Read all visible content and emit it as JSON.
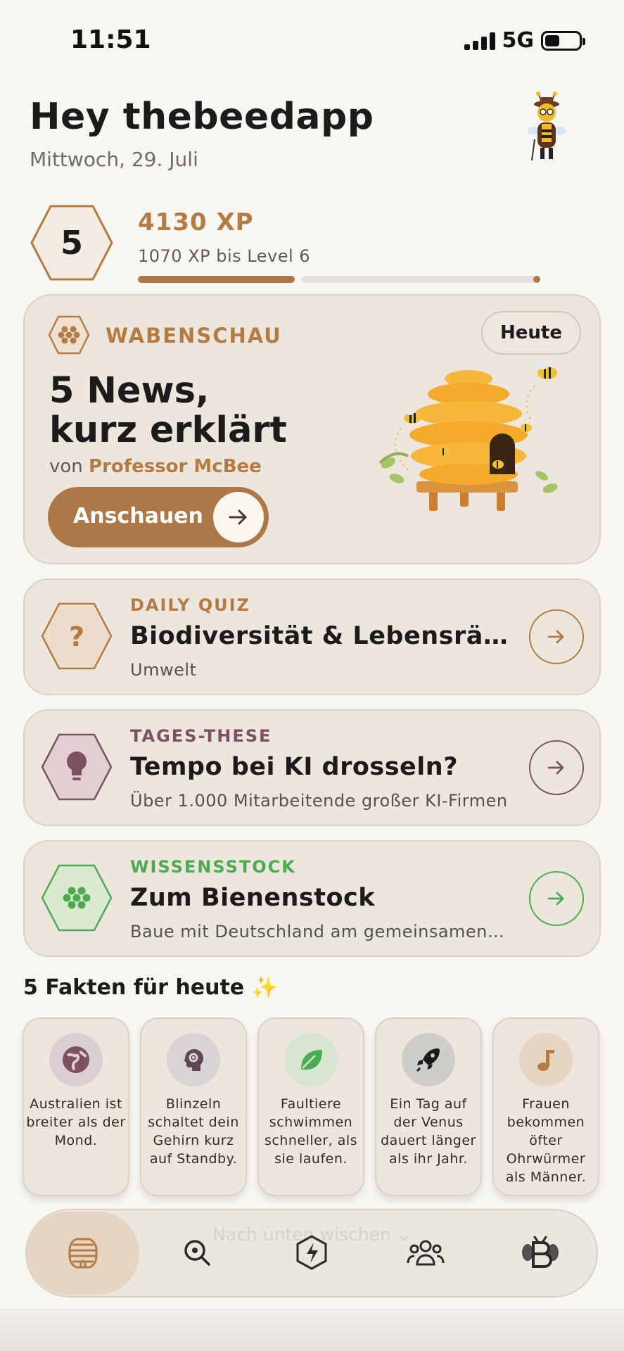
{
  "status_bar": {
    "time": "11:51",
    "network": "5G"
  },
  "header": {
    "greeting": "Hey thebeedapp",
    "date": "Mittwoch, 29. Juli"
  },
  "level": {
    "number": "5",
    "xp": "4130 XP",
    "xp_to_next": "1070 XP bis Level 6",
    "progress_fraction": 0.39
  },
  "hero": {
    "label": "WABENSCHAU",
    "badge": "Heute",
    "title_line1": "5 News,",
    "title_line2": "kurz erklärt",
    "by_prefix": "von",
    "by_author": "Professor McBee",
    "cta": "Anschauen"
  },
  "cards": [
    {
      "eyebrow": "DAILY QUIZ",
      "title": "Biodiversität & Lebensräume",
      "subtitle": "Umwelt",
      "accent": "#b57b45",
      "icon": "question-icon"
    },
    {
      "eyebrow": "TAGES-THESE",
      "title": "Tempo bei KI drosseln?",
      "subtitle": "Über 1.000 Mitarbeitende großer KI-Firmen",
      "accent": "#7d5162",
      "icon": "lightbulb-icon"
    },
    {
      "eyebrow": "WISSENSSTOCK",
      "title": "Zum Bienenstock",
      "subtitle": "Baue mit Deutschland am gemeinsamen Wissen",
      "accent": "#4caa50",
      "icon": "honeycomb-icon"
    }
  ],
  "facts": {
    "title": "5 Fakten für heute ✨",
    "items": [
      {
        "text": "Australien ist breiter als der Mond.",
        "icon": "globe-icon"
      },
      {
        "text": "Blinzeln schaltet dein Gehirn kurz auf Standby.",
        "icon": "brain-gear-icon"
      },
      {
        "text": "Faultiere schwimmen schneller, als sie laufen.",
        "icon": "leaf-icon"
      },
      {
        "text": "Ein Tag auf der Venus dauert länger als ihr Jahr.",
        "icon": "rocket-icon"
      },
      {
        "text": "Frauen bekommen öfter Ohrwürmer als Männer.",
        "icon": "music-note-icon"
      }
    ]
  },
  "nav": {
    "swipe_hint": "Nach unten wischen ⌄",
    "items": [
      "hive-icon",
      "search-icon",
      "lightning-hexagon-icon",
      "community-icon",
      "bee-profile-icon"
    ],
    "active": 0
  },
  "colors": {
    "accent": "#ad7748",
    "background": "#f8f6f1",
    "card": "#ece6dd"
  }
}
